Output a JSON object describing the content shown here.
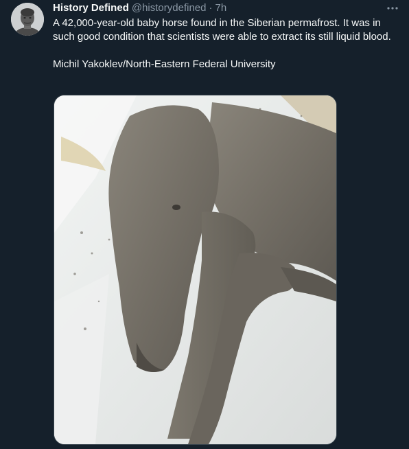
{
  "tweet": {
    "author_name": "History Defined",
    "author_handle": "@historydefined",
    "separator": "·",
    "timestamp": "7h",
    "body_line1": "A 42,000-year-old baby horse found in the Siberian permafrost. It was in such good condition that scientists were able to extract its still liquid blood.",
    "body_line2": "Michil Yakoklev/North-Eastern Federal University"
  },
  "icons": {
    "more": "more-horizontal-icon",
    "avatar": "bust-avatar"
  },
  "colors": {
    "background": "#15202b",
    "text_primary": "#f7f9f9",
    "text_secondary": "#8b98a5",
    "border": "#38444d"
  }
}
